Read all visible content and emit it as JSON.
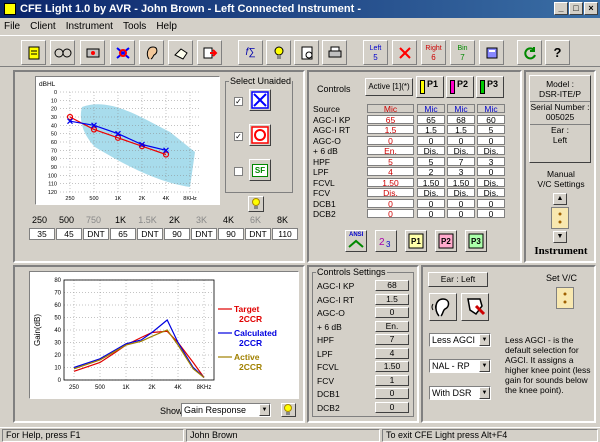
{
  "window": {
    "title": "CFE Light 1.0 by AVR - John Brown - Left Connected Instrument -",
    "controls": [
      "_",
      "□",
      "×"
    ]
  },
  "menu": [
    "File",
    "Client",
    "Instrument",
    "Tools",
    "Help"
  ],
  "toolbar": {
    "left": "Left",
    "left_num": "5",
    "right": "Right",
    "right_num": "6",
    "bin": "Bin",
    "bin_num": "7"
  },
  "audiogram": {
    "y_unit": "dBHL",
    "y_ticks": [
      "0",
      "10",
      "20",
      "30",
      "40",
      "50",
      "60",
      "70",
      "80",
      "90",
      "100",
      "110",
      "120"
    ],
    "x_ticks": [
      "250",
      "500",
      "1K",
      "2K",
      "4K",
      "8KHz"
    ],
    "select_label": "Select Unaided",
    "sf_label": "SF",
    "freq_labels": [
      "250",
      "500",
      "750",
      "1K",
      "1.5K",
      "2K",
      "3K",
      "4K",
      "6K",
      "8K"
    ],
    "thresholds": [
      "35",
      "45",
      "DNT",
      "65",
      "DNT",
      "90",
      "DNT",
      "90",
      "DNT",
      "110"
    ]
  },
  "controls": {
    "header": "Controls",
    "active": "Active [1](*)",
    "programs": [
      "P1",
      "P2",
      "P3"
    ],
    "rows": [
      {
        "name": "Source",
        "vals": [
          "Mic",
          "Mic",
          "Mic",
          "Mic"
        ]
      },
      {
        "name": "AGC-I KP",
        "vals": [
          "65",
          "65",
          "68",
          "60"
        ]
      },
      {
        "name": "AGC-I RT",
        "vals": [
          "1.5",
          "1.5",
          "1.5",
          "5"
        ]
      },
      {
        "name": "AGC-O",
        "vals": [
          "0",
          "0",
          "0",
          "0"
        ]
      },
      {
        "name": "+ 6 dB",
        "vals": [
          "En.",
          "Dis.",
          "Dis.",
          "Dis."
        ]
      },
      {
        "name": "HPF",
        "vals": [
          "5",
          "5",
          "7",
          "3"
        ]
      },
      {
        "name": "LPF",
        "vals": [
          "4",
          "2",
          "3",
          "0"
        ]
      },
      {
        "name": "FCVL",
        "vals": [
          "1.50",
          "1.50",
          "1.50",
          "Dis."
        ]
      },
      {
        "name": "FCV",
        "vals": [
          "Dis.",
          "Dis.",
          "Dis.",
          "Dis."
        ]
      },
      {
        "name": "DCB1",
        "vals": [
          "0",
          "0",
          "0",
          "0"
        ]
      },
      {
        "name": "DCB2",
        "vals": [
          "0",
          "0",
          "0",
          "0"
        ]
      }
    ],
    "ansi": "ANSI"
  },
  "instrument": {
    "model_label": "Model :",
    "model": "DSR-ITE/P",
    "serial_label": "Serial Number :",
    "serial": "005025",
    "ear_label": "Ear :",
    "ear": "Left",
    "manual_vc": "Manual\nV/C Settings",
    "title": "Instrument"
  },
  "gain_chart": {
    "ylabel": "Gain(dB)",
    "y_ticks": [
      "80",
      "70",
      "60",
      "50",
      "40",
      "30",
      "20",
      "10",
      "0"
    ],
    "x_ticks": [
      "250",
      "500",
      "1K",
      "2K",
      "4K",
      "8KHz"
    ],
    "legend": [
      {
        "name": "Target",
        "sub": "2CCR",
        "color": "#e00000"
      },
      {
        "name": "Calculated",
        "sub": "2CCR",
        "color": "#0000e0"
      },
      {
        "name": "Active",
        "sub": "2CCR",
        "color": "#a08000"
      }
    ],
    "show_label": "Show",
    "show_value": "Gain Response"
  },
  "chart_data": {
    "type": "line",
    "x": [
      250,
      500,
      750,
      1000,
      1500,
      2000,
      3000,
      4000,
      6000,
      8000
    ],
    "ylabel": "Gain(dB)",
    "ylim": [
      0,
      80
    ],
    "series": [
      {
        "name": "Target 2CCR",
        "values": [
          7,
          14,
          22,
          28,
          34,
          38,
          39,
          30,
          14,
          2
        ]
      },
      {
        "name": "Calculated 2CCR",
        "values": [
          10,
          17,
          24,
          29,
          32,
          38,
          48,
          30,
          10,
          2
        ]
      },
      {
        "name": "Active 2CCR",
        "values": [
          9,
          16,
          23,
          28,
          31,
          35,
          40,
          28,
          9,
          2
        ]
      }
    ]
  },
  "controls_settings": {
    "title": "Controls Settings",
    "rows": [
      {
        "name": "AGC-I KP",
        "val": "68"
      },
      {
        "name": "AGC-I RT",
        "val": "1.5"
      },
      {
        "name": "AGC-O",
        "val": "0"
      },
      {
        "name": "+ 6 dB",
        "val": "En."
      },
      {
        "name": "HPF",
        "val": "7"
      },
      {
        "name": "LPF",
        "val": "4"
      },
      {
        "name": "FCVL",
        "val": "1.50"
      },
      {
        "name": "FCV",
        "val": "1"
      },
      {
        "name": "DCB1",
        "val": "0"
      },
      {
        "name": "DCB2",
        "val": "0"
      }
    ]
  },
  "ear_box": "Ear : Left",
  "dropdowns": [
    "Less AGCI",
    "NAL - RP",
    "With DSR"
  ],
  "set_vc": "Set V/C",
  "description": "Less AGCI - is the default selection for AGCI. It assigns a higher knee point (less gain for sounds below the knee point).",
  "status": {
    "help": "For Help, press F1",
    "client": "John Brown",
    "exit": "To exit CFE Light press Alt+F4"
  },
  "colors": {
    "title_bar": "#0a246a",
    "face": "#d4d0c8",
    "mic_red": "#e00000",
    "shade": "#a8dcec"
  }
}
